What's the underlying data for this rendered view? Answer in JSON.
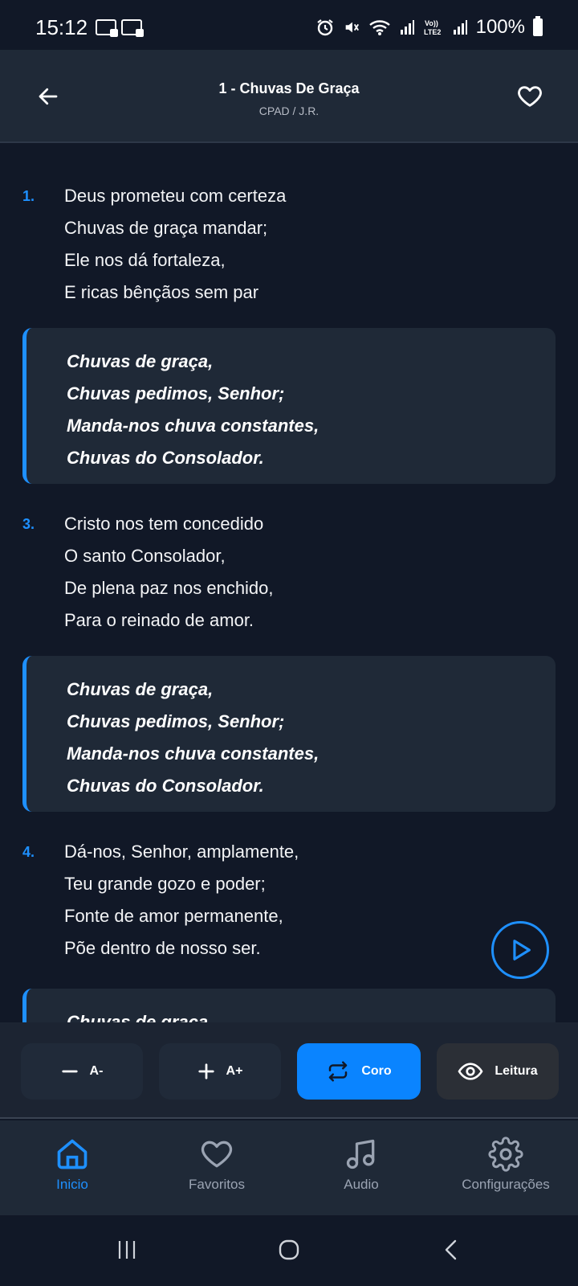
{
  "status_bar": {
    "time": "15:12",
    "battery_text": "100%",
    "icons": [
      "notification-icon",
      "notification-icon",
      "alarm-icon",
      "mute-icon",
      "wifi-icon",
      "signal-icon",
      "volte-lte2-icon",
      "signal-icon",
      "battery-icon"
    ]
  },
  "header": {
    "title": "1 - Chuvas De Graça",
    "subtitle": "CPAD / J.R.",
    "back_icon": "arrow-left-icon",
    "favorite_icon": "heart-outline-icon"
  },
  "hymn": {
    "verses": [
      {
        "number": "1.",
        "lines": [
          "Deus prometeu com certeza",
          "Chuvas de graça mandar;",
          "Ele nos dá fortaleza,",
          "E ricas bênçãos sem par"
        ]
      },
      {
        "number": "3.",
        "lines": [
          "Cristo nos tem concedido",
          "O santo Consolador,",
          "De plena paz nos enchido,",
          "Para o reinado de amor."
        ]
      },
      {
        "number": "4.",
        "lines": [
          "Dá-nos, Senhor, amplamente,",
          "Teu grande gozo e poder;",
          "Fonte de amor permanente,",
          "Põe dentro de nosso ser."
        ]
      }
    ],
    "chorus": {
      "lines": [
        "Chuvas de graça,",
        "Chuvas pedimos, Senhor;",
        "Manda-nos chuva constantes,",
        "Chuvas do Consolador."
      ]
    },
    "partial_chorus_line": "Chuvas de graça,"
  },
  "controls": {
    "decrease_label": "A-",
    "increase_label": "A+",
    "chorus_label": "Coro",
    "reading_label": "Leitura"
  },
  "bottom_nav": {
    "items": [
      {
        "label": "Inicio",
        "icon": "home-icon",
        "active": true
      },
      {
        "label": "Favoritos",
        "icon": "heart-icon",
        "active": false
      },
      {
        "label": "Audio",
        "icon": "music-note-icon",
        "active": false
      },
      {
        "label": "Configurações",
        "icon": "gear-icon",
        "active": false
      }
    ]
  },
  "colors": {
    "accent": "#1e90ff",
    "background": "#111827",
    "surface": "#1f2937",
    "active_button": "#0a84ff"
  }
}
